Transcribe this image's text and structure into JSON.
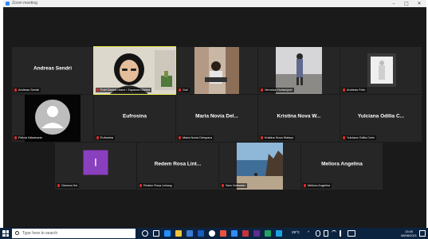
{
  "window": {
    "title": "Zoom meeting",
    "controls": {
      "minimize": "–",
      "maximize": "□",
      "close": "✕"
    }
  },
  "participants": [
    {
      "id": "andreas",
      "big_name": "Andreas Sendri",
      "label": "Andreas Sendri",
      "kind": "name"
    },
    {
      "id": "active",
      "big_name": "",
      "label": "Putri Darma Utami / Zayanna Dilahra",
      "kind": "video",
      "active": true
    },
    {
      "id": "guil",
      "big_name": "",
      "label": "Guil",
      "kind": "video"
    },
    {
      "id": "veronica",
      "big_name": "",
      "label": "Veronica Hurtaniputri",
      "kind": "video"
    },
    {
      "id": "andreas-felix",
      "big_name": "",
      "label": "Andreas Felix",
      "kind": "video"
    },
    {
      "id": "felicia",
      "big_name": "",
      "label": "Felicia Nilavicanis",
      "kind": "avatar"
    },
    {
      "id": "eufrosina",
      "big_name": "Eufrosina",
      "label": "Eufrosina",
      "kind": "name"
    },
    {
      "id": "maria",
      "big_name": "Maria Novia Del...",
      "label": "Maria Novia Delopaus",
      "kind": "name"
    },
    {
      "id": "kristina",
      "big_name": "Kristina Nova W...",
      "label": "Kristina Nova Waleyo",
      "kind": "name"
    },
    {
      "id": "yulciana",
      "big_name": "Yulciana Odilia C...",
      "label": "Yulciana Odilia Ceric",
      "kind": "name"
    },
    {
      "id": "gemma",
      "big_name": "",
      "label": "Gemma Hoi",
      "kind": "initial",
      "initial": "I",
      "initial_color": "#8a3fbf"
    },
    {
      "id": "redem",
      "big_name": "Redem Rosa Lint...",
      "label": "Redem Rosa Lintang",
      "kind": "name"
    },
    {
      "id": "sam",
      "big_name": "",
      "label": "Sam Holtwater",
      "kind": "video"
    },
    {
      "id": "meliora",
      "big_name": "Meliora Angelina",
      "label": "Meliora Angelina",
      "kind": "name"
    }
  ],
  "taskbar": {
    "search_placeholder": "Type here to search",
    "tray_text": "29°C",
    "time": "13:45",
    "date": "08/08/2021"
  }
}
